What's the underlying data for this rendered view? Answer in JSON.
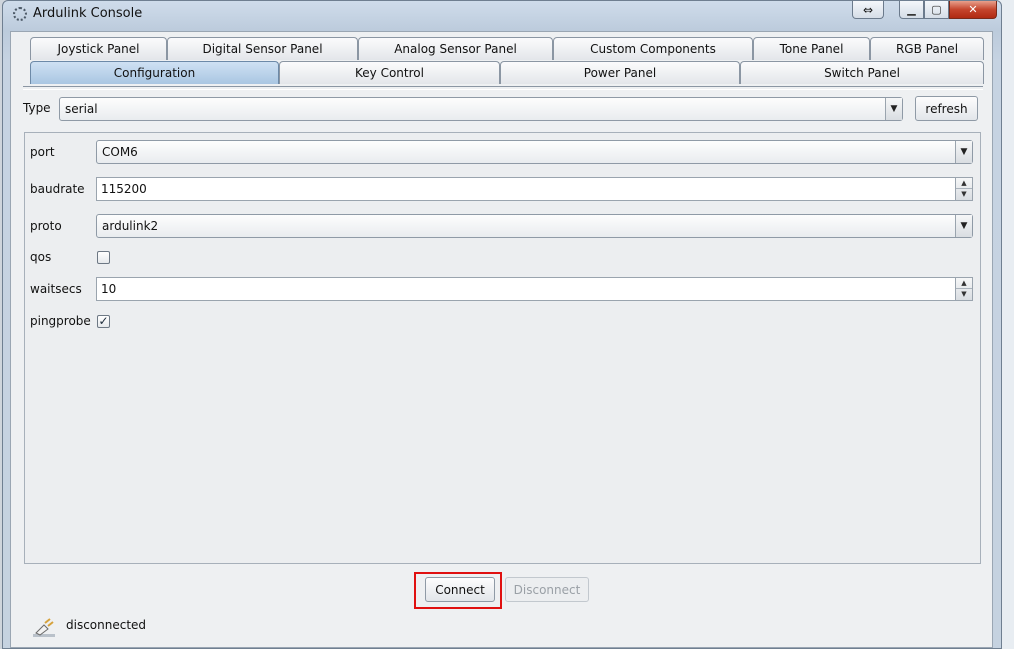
{
  "window": {
    "title": "Ardulink Console",
    "close_glyph": "✕",
    "min_glyph": "▁",
    "max_glyph": "▢",
    "restore_glyph": "⇔"
  },
  "tabs": {
    "row1": [
      "Joystick Panel",
      "Digital Sensor Panel",
      "Analog Sensor Panel",
      "Custom Components",
      "Tone Panel",
      "RGB Panel"
    ],
    "row2": [
      "Configuration",
      "Key Control",
      "Power Panel",
      "Switch Panel"
    ],
    "selected": "Configuration"
  },
  "connection": {
    "type_label": "Type",
    "type_value": "serial",
    "refresh_label": "refresh"
  },
  "config": {
    "port": {
      "label": "port",
      "value": "COM6"
    },
    "baudrate": {
      "label": "baudrate",
      "value": "115200"
    },
    "proto": {
      "label": "proto",
      "value": "ardulink2"
    },
    "qos": {
      "label": "qos",
      "checked": false
    },
    "waitsecs": {
      "label": "waitsecs",
      "value": "10"
    },
    "pingprobe": {
      "label": "pingprobe",
      "checked": true,
      "check_glyph": "✓"
    }
  },
  "actions": {
    "connect_label": "Connect",
    "disconnect_label": "Disconnect"
  },
  "status": {
    "text": "disconnected",
    "icon": "plug-icon"
  },
  "colors": {
    "highlight": "#e01010",
    "selected_tab": "#a9c6e2"
  }
}
